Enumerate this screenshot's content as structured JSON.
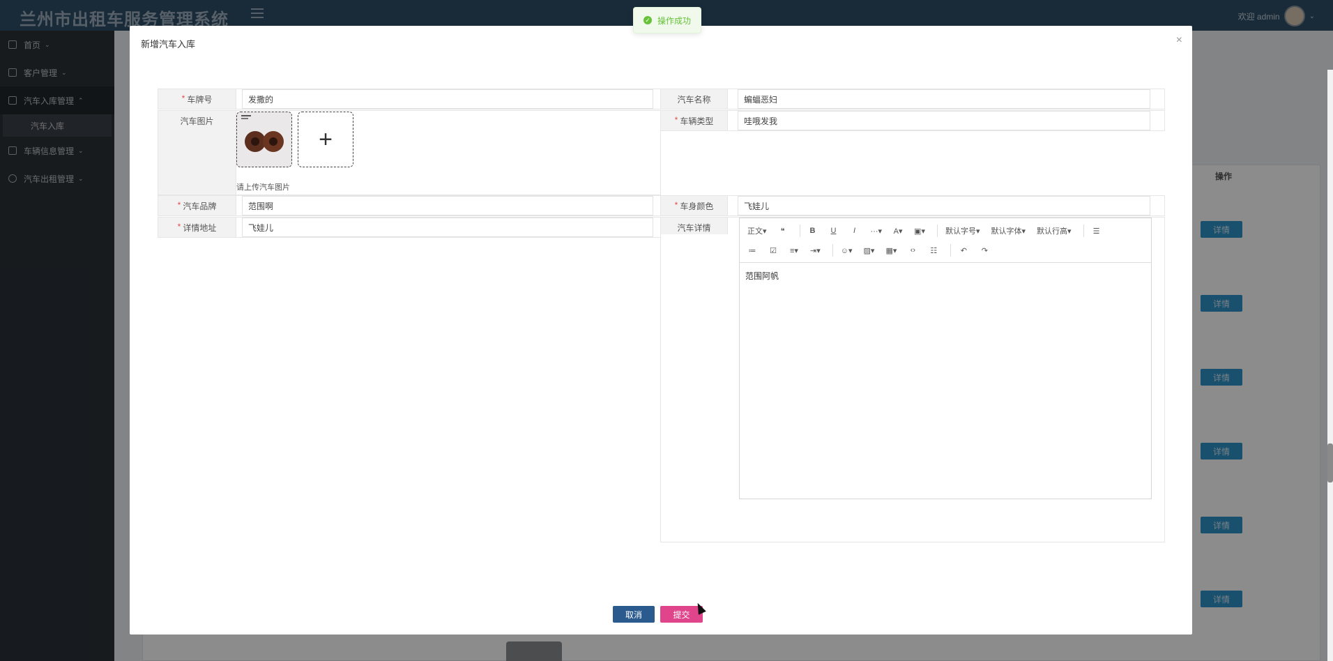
{
  "app": {
    "brand": "兰州市出租车服务管理系统"
  },
  "header": {
    "welcome": "欢迎 admin"
  },
  "sidebar": {
    "items": [
      {
        "label": "首页"
      },
      {
        "label": "客户管理"
      },
      {
        "label": "汽车入库管理"
      },
      {
        "label": "车辆信息管理"
      },
      {
        "label": "汽车出租管理"
      }
    ],
    "sub_item": "汽车入库"
  },
  "table": {
    "op_header": "操作",
    "detail_label": "详情"
  },
  "toast": {
    "message": "操作成功"
  },
  "modal": {
    "title": "新增汽车入库",
    "close": "×",
    "fields": {
      "plate": {
        "label": "车牌号",
        "value": "发撒的"
      },
      "car_name": {
        "label": "汽车名称",
        "value": "蝙蝠恶妇"
      },
      "image": {
        "label": "汽车图片",
        "tip": "请上传汽车图片"
      },
      "vehicle_type": {
        "label": "车辆类型",
        "value": "哇哦发我"
      },
      "brand": {
        "label": "汽车品牌",
        "value": "范围啊"
      },
      "color": {
        "label": "车身颜色",
        "value": "飞娃儿"
      },
      "address": {
        "label": "详情地址",
        "value": "飞娃儿"
      },
      "detail": {
        "label": "汽车详情",
        "content": "范围阿帆"
      }
    },
    "editor_toolbar": {
      "paragraph": "正文",
      "font_size": "默认字号",
      "font_family": "默认字体",
      "line_height": "默认行高"
    },
    "buttons": {
      "cancel": "取消",
      "submit": "提交"
    }
  },
  "colors": {
    "accent": "#2f93c8",
    "submit": "#e0448a",
    "cancel": "#2a5a8e",
    "success": "#67c23a"
  }
}
